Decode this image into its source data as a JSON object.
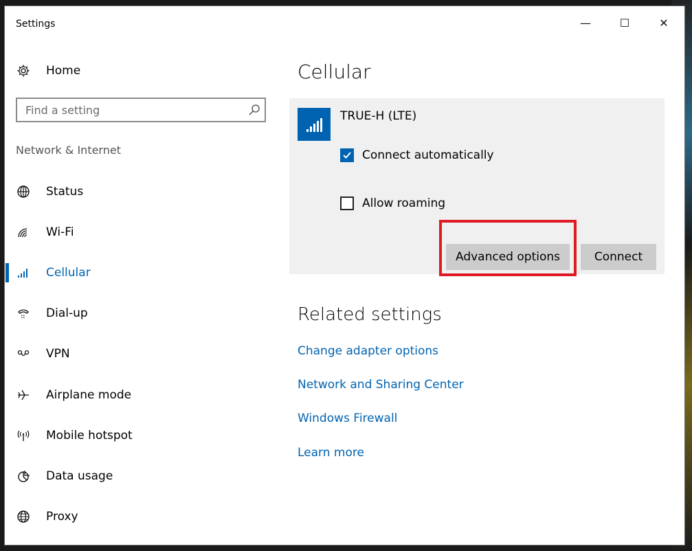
{
  "window": {
    "title": "Settings",
    "minimize_glyph": "—",
    "maximize_glyph": "☐",
    "close_glyph": "✕"
  },
  "sidebar": {
    "home_label": "Home",
    "search_placeholder": "Find a setting",
    "section_label": "Network & Internet",
    "items": [
      {
        "label": "Status",
        "icon": "globe-status-icon"
      },
      {
        "label": "Wi-Fi",
        "icon": "wifi-icon"
      },
      {
        "label": "Cellular",
        "icon": "cellular-signal-icon",
        "active": true
      },
      {
        "label": "Dial-up",
        "icon": "dial-up-icon"
      },
      {
        "label": "VPN",
        "icon": "vpn-icon"
      },
      {
        "label": "Airplane mode",
        "icon": "airplane-icon"
      },
      {
        "label": "Mobile hotspot",
        "icon": "hotspot-icon"
      },
      {
        "label": "Data usage",
        "icon": "pie-chart-icon"
      },
      {
        "label": "Proxy",
        "icon": "globe-icon"
      }
    ]
  },
  "main": {
    "page_title": "Cellular",
    "network": {
      "name": "TRUE-H (LTE)",
      "connect_automatically_label": "Connect automatically",
      "connect_automatically": true,
      "allow_roaming_label": "Allow roaming",
      "allow_roaming": false,
      "advanced_options_label": "Advanced options",
      "connect_label": "Connect"
    },
    "related": {
      "title": "Related settings",
      "links": [
        "Change adapter options",
        "Network and Sharing Center",
        "Windows Firewall",
        "Learn more"
      ]
    }
  },
  "colors": {
    "accent": "#0063b1",
    "highlight": "#e01a24",
    "panel": "#f0f0f0",
    "button": "#cccccc"
  }
}
